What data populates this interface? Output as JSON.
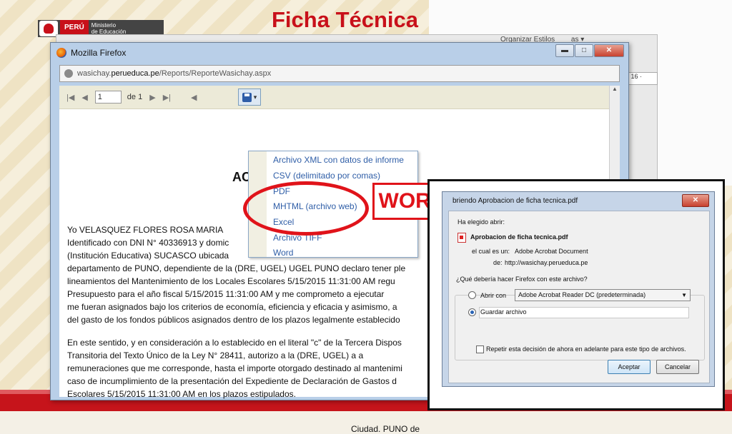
{
  "slide": {
    "title": "Ficha Técnica",
    "logo": {
      "country": "PERÚ",
      "ministry_line1": "Ministerio",
      "ministry_line2": "de Educación"
    },
    "annotation_label": "WORD",
    "colors": {
      "title_red": "#c8101a",
      "highlight_red": "#e0131a",
      "footer_red": "#c6141b"
    }
  },
  "word_backdrop": {
    "ribbon_text": "Organizar   Estilos",
    "ribbon_text2": "as ▾",
    "ruler_text": "· 16 ·"
  },
  "firefox": {
    "window_title": "Mozilla Firefox",
    "url_domain_prefix": "wasichay.",
    "url_domain": "perueduca.pe",
    "url_path": "/Reports/ReporteWasichay.aspx",
    "window_buttons": {
      "minimize": "▬",
      "maximize": "□",
      "close": "✕"
    }
  },
  "report_toolbar": {
    "page_value": "1",
    "page_of": "de 1",
    "first_icon": "first-page-icon",
    "prev_icon": "prev-page-icon",
    "next_icon": "next-page-icon",
    "last_icon": "last-page-icon",
    "back_icon": "back-icon",
    "export_icon": "save-export-icon"
  },
  "export_menu": {
    "items": [
      "Archivo XML con datos de informe",
      "CSV (delimitado por comas)",
      "PDF",
      "MHTML (archivo web)",
      "Excel",
      "Archivo TIFF",
      "Word"
    ]
  },
  "document": {
    "heading": "AC",
    "lines": [
      "Yo  VELASQUEZ FLORES ROSA MARIA",
      "Identificado con DNI N° 40336913 y  domic",
      "(Institución Educativa) SUCASCO ubicada",
      "departamento de PUNO, dependiente de la (DRE, UGEL) UGEL PUNO declaro tener  ple",
      "lineamientos del Mantenimiento de los Locales  Escolares  5/15/2015 11:31:00 AM  regu",
      "Presupuesto para  el  año fiscal 5/15/2015 11:31:00 AM y me comprometo  a  ejecutar",
      "me fueran asignados bajo los criterios de  economía, eficiencia y eficacia y asimismo, a",
      "del gasto de los  fondos públicos asignados dentro de los plazos legalmente establecido"
    ],
    "lines2": [
      "En este sentido, y en consideración a lo establecido en el literal \"c\" de la Tercera Dispos",
      "Transitoria del Texto Único de la Ley N° 28411, autorizo a la  (DRE, UGEL) a a",
      "remuneraciones que me corresponde, hasta el importe otorgado destinado al mantenimi",
      "caso  de  incumplimiento de la presentación del Expediente de Declaración de Gastos d",
      "Escolares 5/15/2015 11:31:00 AM en los plazos estipulados."
    ],
    "city": "Ciudad. PUNO de"
  },
  "dialog": {
    "title": "briendo Aprobacion de ficha tecnica.pdf",
    "close": "✕",
    "intro": "Ha elegido abrir:",
    "filename": "Aprobacion de ficha tecnica.pdf",
    "type_label": "el cual es un:",
    "type_value": "Adobe Acrobat Document",
    "from_label": "de:",
    "from_value": "http://wasichay.perueduca.pe",
    "question": "¿Qué debería hacer Firefox con este archivo?",
    "open_with_label": "Abrir con",
    "open_with_value": "Adobe Acrobat Reader DC  (predeterminada)",
    "save_label": "Guardar archivo",
    "remember_label": "Repetir esta decisión de ahora en adelante para este tipo de archivos.",
    "accept": "Aceptar",
    "cancel": "Cancelar",
    "selected_option": "save"
  }
}
